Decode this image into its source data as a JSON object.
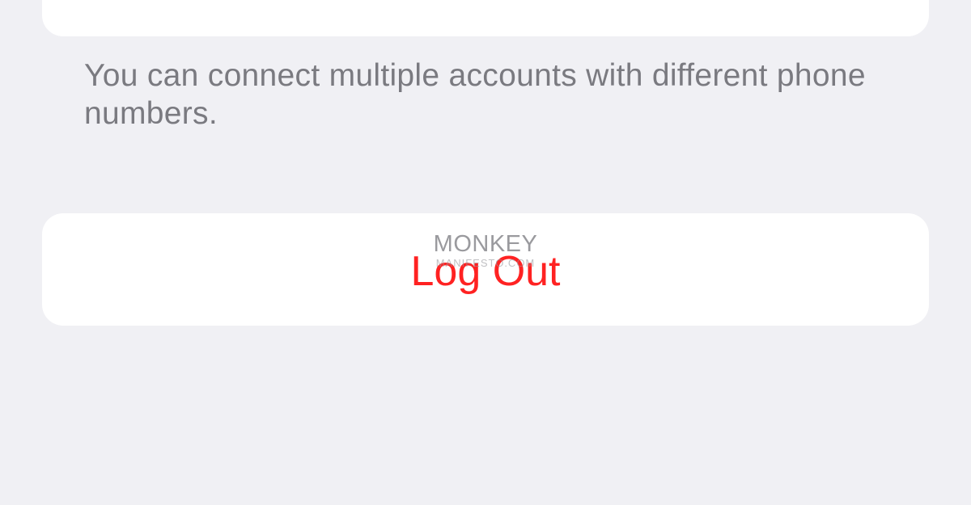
{
  "accounts_section": {
    "footer_note": "You can connect multiple accounts with different phone numbers."
  },
  "logout": {
    "label": "Log Out",
    "color": "#ff2222"
  },
  "watermark": {
    "main": "MONKEY",
    "sub": "MANIFESTO.COM"
  },
  "colors": {
    "background": "#f0f0f4",
    "card": "#ffffff",
    "secondary_text": "#7a7a80"
  }
}
